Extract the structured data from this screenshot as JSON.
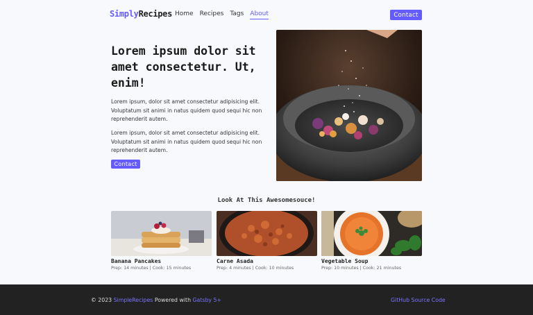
{
  "nav": {
    "logo_part1": "Simply",
    "logo_part2": "Recipes",
    "links": [
      "Home",
      "Recipes",
      "Tags",
      "About"
    ],
    "active_link": "About",
    "contact_label": "Contact"
  },
  "hero": {
    "title": "Lorem ipsum dolor sit amet consectetur. Ut, enim!",
    "paragraph1": "Lorem ipsum, dolor sit amet consectetur adipisicing elit. Voluptatum sit animi in natus quidem quod sequi hic non reprehenderit autem.",
    "paragraph2": "Lorem ipsum, dolor sit amet consectetur adipisicing elit. Voluptatum sit animi in natus quidem quod sequi hic non reprehenderit autem.",
    "contact_label": "Contact"
  },
  "featured": {
    "title": "Look At This Awesomesouce!",
    "recipes": [
      {
        "name": "Banana Pancakes",
        "meta": "Prep: 14 minutes | Cook: 15 minutes"
      },
      {
        "name": "Carne Asada",
        "meta": "Prep: 4 minutes | Cook: 10 minutes"
      },
      {
        "name": "Vegetable Soup",
        "meta": "Prep: 10 minutes | Cook: 21 minutes"
      }
    ]
  },
  "footer": {
    "copyright": "© 2023",
    "site_link": "SimpleRecipes",
    "powered_text": "Powered with",
    "gatsby_link": "Gatsby 5+",
    "github_link": "GitHub Source Code"
  },
  "colors": {
    "accent": "#645cff",
    "footer_bg": "#222222"
  }
}
